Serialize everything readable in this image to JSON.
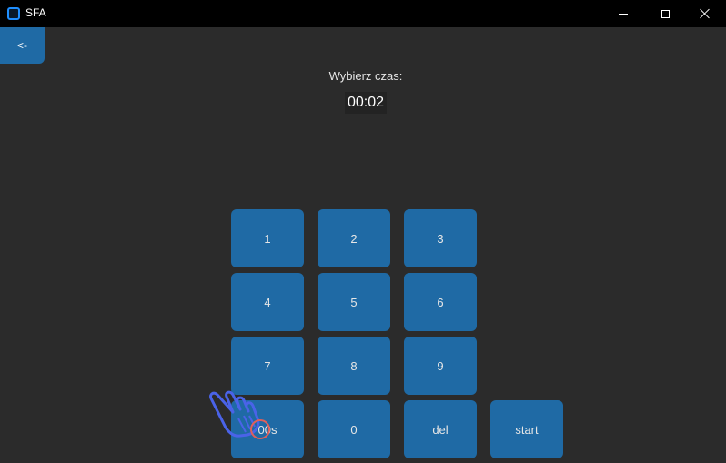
{
  "window": {
    "title": "SFA"
  },
  "back_button": {
    "label": "<-"
  },
  "timer": {
    "prompt": "Wybierz czas:",
    "value": "00:02"
  },
  "keypad": {
    "k1": "1",
    "k2": "2",
    "k3": "3",
    "k4": "4",
    "k5": "5",
    "k6": "6",
    "k7": "7",
    "k8": "8",
    "k9": "9",
    "k00s": "00s",
    "k0": "0",
    "del": "del",
    "start": "start"
  },
  "colors": {
    "background": "#2b2b2b",
    "titlebar": "#000000",
    "button": "#1f6aa5",
    "display_bg": "#232323",
    "app_icon": "#1f8fff"
  },
  "icons": {
    "app": "app-icon",
    "minimize": "minimize-icon",
    "maximize": "maximize-icon",
    "close": "close-icon",
    "cursor": "hand-pointer-icon"
  }
}
